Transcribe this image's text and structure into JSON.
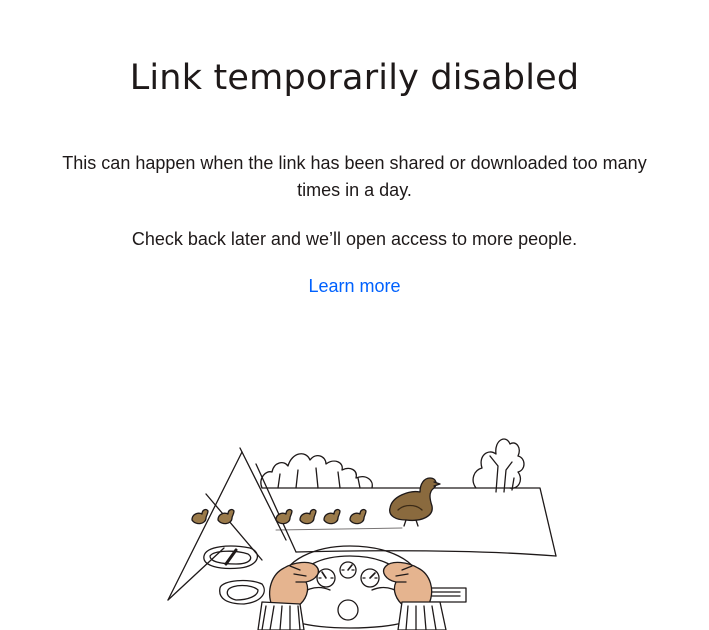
{
  "heading": "Link temporarily disabled",
  "paragraphs": {
    "first": "This can happen when the link has been shared or downloaded too many times in a day.",
    "second": "Check back later and we’ll open access to more people."
  },
  "link": {
    "label": "Learn more"
  },
  "colors": {
    "text": "#1e1919",
    "link": "#0061fe",
    "duck": "#8a6a3e",
    "skin": "#e5b48f"
  },
  "illustration": {
    "subject": "car-dashboard-ducks"
  }
}
